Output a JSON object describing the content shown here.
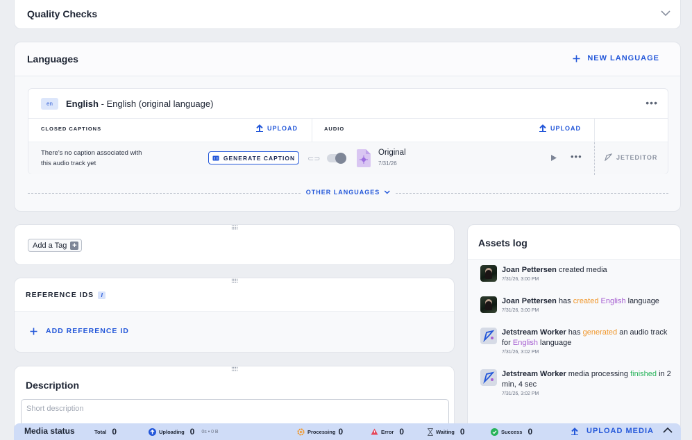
{
  "quality_checks": {
    "title": "Quality Checks"
  },
  "languages": {
    "title": "Languages",
    "new_language_label": "NEW LANGUAGE",
    "entry": {
      "badge": "en",
      "name": "English",
      "detail": "- English (original language)",
      "closed_captions_label": "CLOSED CAPTIONS",
      "cc_upload_label": "UPLOAD",
      "audio_label": "AUDIO",
      "audio_upload_label": "UPLOAD",
      "no_caption_text": "There's no caption associated with this audio track yet",
      "generate_caption_label": "GENERATE CAPTION",
      "audio_track_name": "Original",
      "audio_track_date": "7/31/26",
      "jeteditor_label": "JETEDITOR"
    },
    "other_languages_label": "OTHER LANGUAGES"
  },
  "tags": {
    "add_tag_label": "Add a Tag"
  },
  "reference_ids": {
    "title": "REFERENCE IDS",
    "add_label": "ADD REFERENCE ID"
  },
  "description": {
    "title": "Description",
    "placeholder": "Short description"
  },
  "assets_log": {
    "title": "Assets log",
    "entries": [
      {
        "actor": "Joan Pettersen",
        "text": "created media",
        "date": "7/31/26, 3:00 PM"
      },
      {
        "actor": "Joan Pettersen",
        "pre": "has",
        "action": "created",
        "lang": "English",
        "post": "language",
        "date": "7/31/26, 3:00 PM"
      },
      {
        "actor": "Jetstream Worker",
        "pre": "has",
        "action": "generated",
        "mid": "an audio track for",
        "lang": "English",
        "post": "language",
        "date": "7/31/26, 3:02 PM"
      },
      {
        "actor": "Jetstream Worker",
        "pre": "media processing",
        "action": "finished",
        "post": "in 2 min, 4 sec",
        "date": "7/31/26, 3:02 PM"
      }
    ]
  },
  "media_status": {
    "title": "Media status",
    "total_label": "Total",
    "total": "0",
    "uploading_label": "Uploading",
    "uploading": "0",
    "uploading_sub": "0s • 0 B",
    "processing_label": "Processing",
    "processing": "0",
    "error_label": "Error",
    "error": "0",
    "waiting_label": "Waiting",
    "waiting": "0",
    "success_label": "Success",
    "success": "0",
    "upload_media_label": "UPLOAD MEDIA"
  },
  "colors": {
    "accent": "#2357d9",
    "created": "#f0972b",
    "language": "#a65fd1",
    "finished": "#27b35a"
  }
}
